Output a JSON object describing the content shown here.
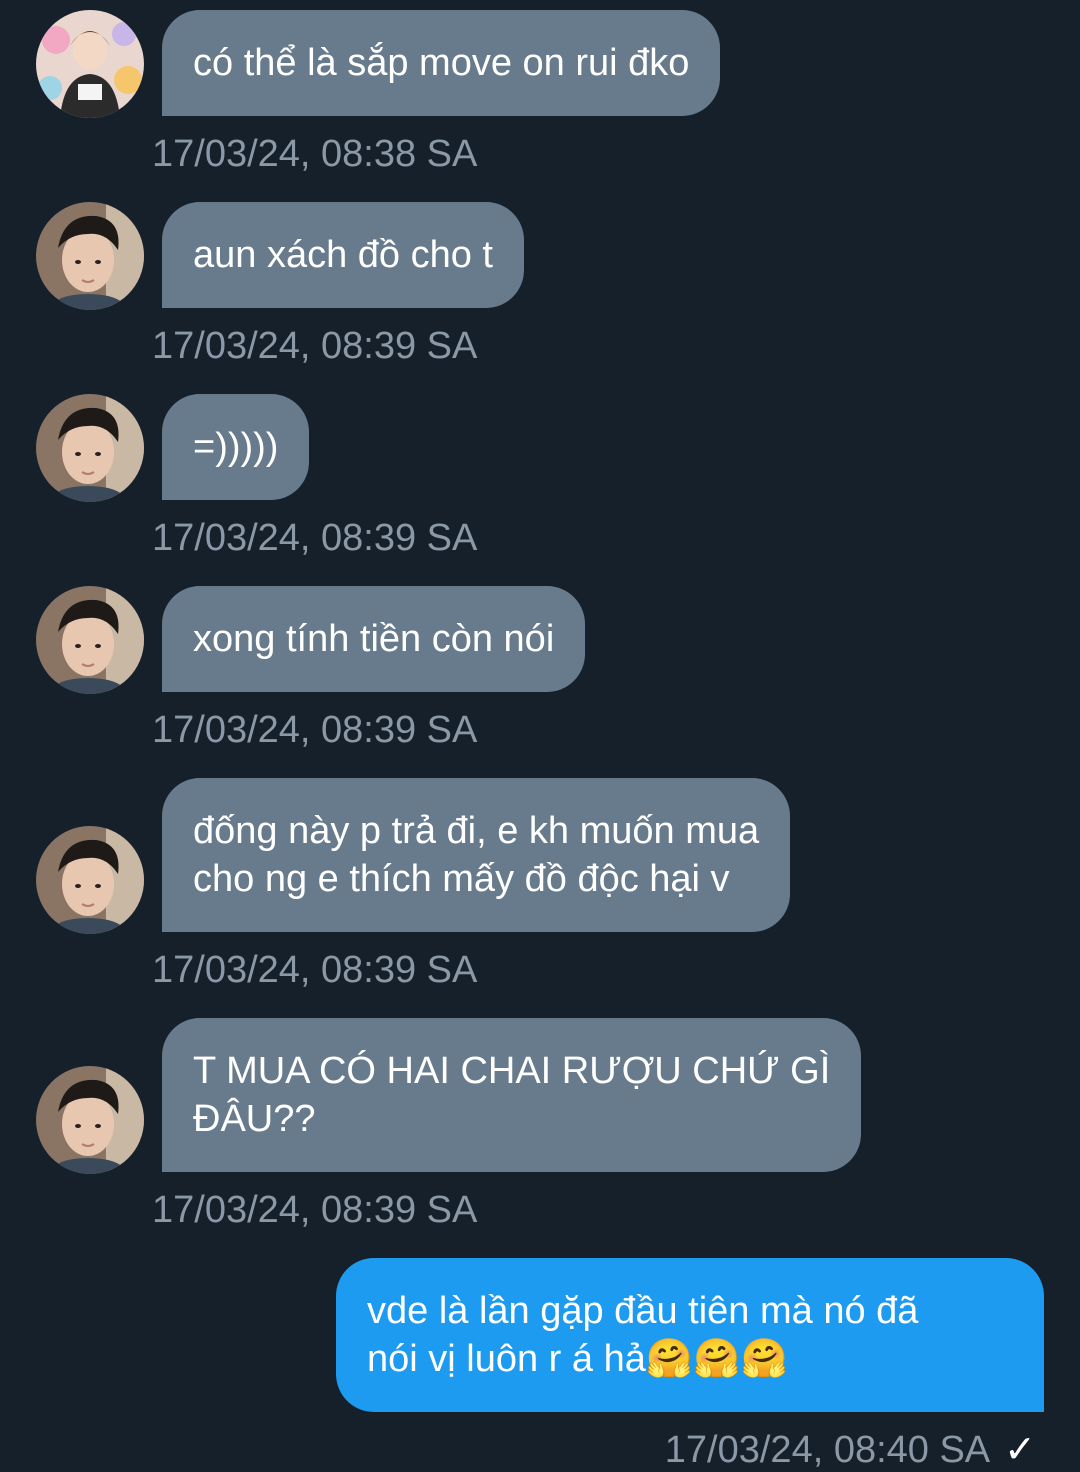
{
  "colors": {
    "background": "#15202b",
    "incoming_bubble": "#687b8d",
    "outgoing_bubble": "#1d9bf0",
    "timestamp": "#8b98a5"
  },
  "messages": [
    {
      "text": "có thể là sắp move on rui đko",
      "time": "17/03/24, 08:38 SA",
      "avatar": "user-a-avatar"
    },
    {
      "text": "aun xách đồ cho t",
      "time": "17/03/24, 08:39 SA",
      "avatar": "user-b-avatar"
    },
    {
      "text": "=)))))",
      "time": "17/03/24, 08:39 SA",
      "avatar": "user-b-avatar"
    },
    {
      "text": "xong tính tiền còn nói",
      "time": "17/03/24, 08:39 SA",
      "avatar": "user-b-avatar"
    },
    {
      "text": "đống này p trả đi, e kh muốn mua\ncho ng e thích mấy đồ độc hại v",
      "time": "17/03/24, 08:39 SA",
      "avatar": "user-b-avatar"
    },
    {
      "text": "T MUA CÓ HAI CHAI RƯỢU CHỨ GÌ\nĐÂU??",
      "time": "17/03/24, 08:39 SA",
      "avatar": "user-b-avatar"
    },
    {
      "text": "vde là lần gặp đầu tiên mà nó đã\nnói vị luôn r á hả🤗🤗🤗",
      "time": "17/03/24, 08:40 SA",
      "status_icon": "checkmark-icon"
    }
  ]
}
